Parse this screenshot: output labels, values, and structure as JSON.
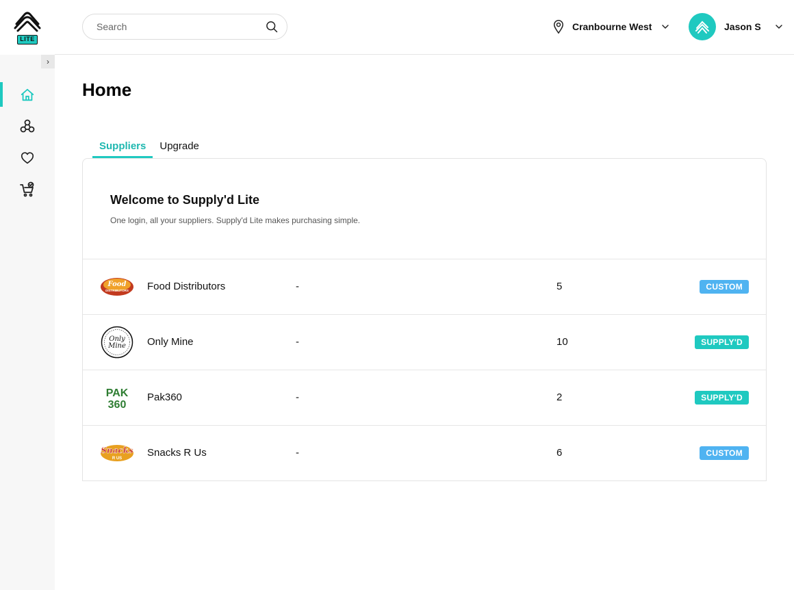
{
  "brand": {
    "badge": "LITE",
    "accent": "#1fc9c0"
  },
  "sidebar": {
    "collapse_label": "›",
    "items": [
      {
        "icon": "home-icon",
        "active": true
      },
      {
        "icon": "suppliers-icon",
        "active": false
      },
      {
        "icon": "heart-icon",
        "active": false
      },
      {
        "icon": "cart-icon",
        "active": false
      }
    ]
  },
  "header": {
    "search": {
      "placeholder": "Search",
      "value": ""
    },
    "location": "Cranbourne West",
    "user": "Jason S"
  },
  "main": {
    "title": "Home",
    "tabs": [
      {
        "label": "Suppliers",
        "active": true
      },
      {
        "label": "Upgrade",
        "active": false
      }
    ],
    "welcome": {
      "title": "Welcome to Supply'd Lite",
      "subtitle": "One login, all your suppliers. Supply'd Lite makes purchasing simple."
    },
    "suppliers": [
      {
        "name": "Food Distributors",
        "detail": "-",
        "count": "5",
        "badge": "CUSTOM",
        "badge_type": "custom",
        "logo_text": "Food",
        "logo_sub": "DISTRIBUTORS"
      },
      {
        "name": "Only Mine",
        "detail": "-",
        "count": "10",
        "badge": "SUPPLY'D",
        "badge_type": "supplyd",
        "logo_text": "Only",
        "logo_sub": "Mine"
      },
      {
        "name": "Pak360",
        "detail": "-",
        "count": "2",
        "badge": "SUPPLY'D",
        "badge_type": "supplyd",
        "logo_text": "PAK",
        "logo_sub": "360"
      },
      {
        "name": "Snacks R Us",
        "detail": "-",
        "count": "6",
        "badge": "CUSTOM",
        "badge_type": "custom",
        "logo_text": "Snacks",
        "logo_sub": "R US"
      }
    ]
  }
}
